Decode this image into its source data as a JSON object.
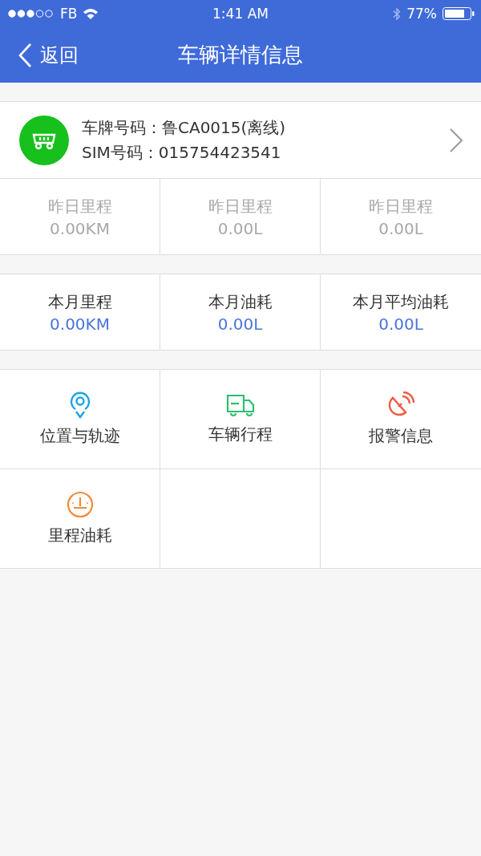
{
  "status_bar": {
    "carrier": "FB",
    "time": "1:41 AM",
    "battery": "77%"
  },
  "nav": {
    "back": "返回",
    "title": "车辆详情信息"
  },
  "vehicle": {
    "plate_label": "车牌号码：",
    "plate": "鲁CA0015(离线)",
    "sim_label": "SIM号码：",
    "sim": "015754423541"
  },
  "stats_yesterday": [
    {
      "label": "昨日里程",
      "value": "0.00KM"
    },
    {
      "label": "昨日里程",
      "value": "0.00L"
    },
    {
      "label": "昨日里程",
      "value": "0.00L"
    }
  ],
  "stats_month": [
    {
      "label": "本月里程",
      "value": "0.00KM"
    },
    {
      "label": "本月油耗",
      "value": "0.00L"
    },
    {
      "label": "本月平均油耗",
      "value": "0.00L"
    }
  ],
  "menu": [
    {
      "kind": "location",
      "label": "位置与轨迹",
      "color": "#1aa3e8"
    },
    {
      "kind": "truck",
      "label": "车辆行程",
      "color": "#2cbf6e"
    },
    {
      "kind": "alarm",
      "label": "报警信息",
      "color": "#ee5a42"
    },
    {
      "kind": "gauge",
      "label": "里程油耗",
      "color": "#f28a3c"
    }
  ]
}
